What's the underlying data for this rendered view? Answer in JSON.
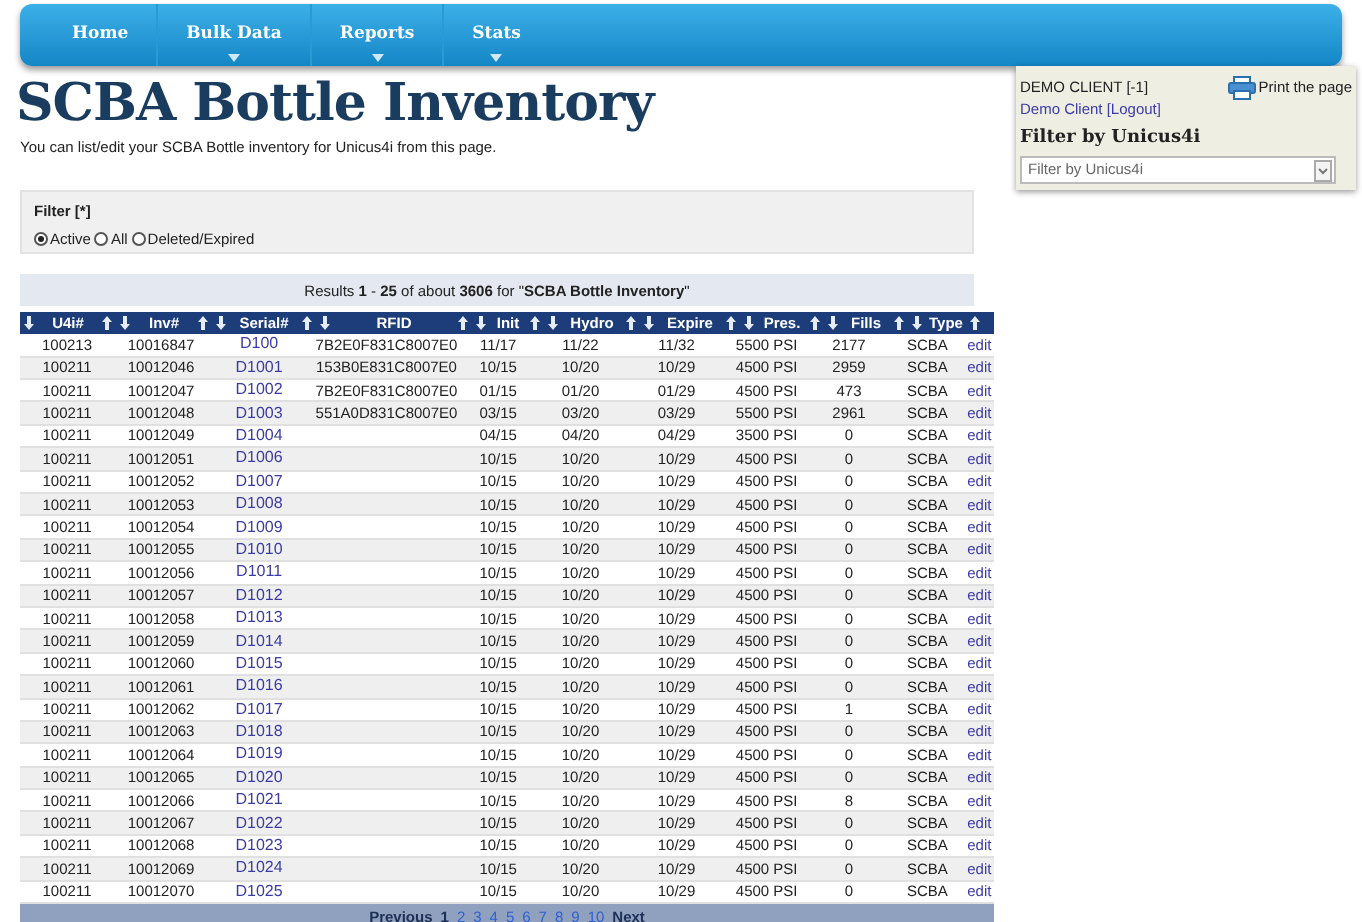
{
  "nav": [
    {
      "label": "Home",
      "has_menu": false
    },
    {
      "label": "Bulk Data",
      "has_menu": true
    },
    {
      "label": "Reports",
      "has_menu": true
    },
    {
      "label": "Stats",
      "has_menu": true
    }
  ],
  "title": "SCBA Bottle Inventory",
  "subtitle": "You can list/edit your SCBA Bottle inventory for Unicus4i from this page.",
  "filter": {
    "label": "Filter [*]",
    "options": [
      {
        "label": "Active",
        "selected": true
      },
      {
        "label": "All",
        "selected": false
      },
      {
        "label": "Deleted/Expired",
        "selected": false
      }
    ]
  },
  "results": "Results **1** - **25** of about **3606** for \"**SCBA Bottle Inventory**\"",
  "table": {
    "columns": [
      "U4i#",
      "Inv#",
      "Serial#",
      "RFID",
      "Init",
      "Hydro",
      "Expire",
      "Pres.",
      "Fills",
      "Type"
    ],
    "rows": [
      [
        "100213",
        "10016847",
        "D100",
        "7B2E0F831C8007E0",
        "11/17",
        "11/22",
        "11/32",
        "5500 PSI",
        "2177",
        "SCBA",
        "edit"
      ],
      [
        "100211",
        "10012046",
        "D1001",
        "153B0E831C8007E0",
        "10/15",
        "10/20",
        "10/29",
        "4500 PSI",
        "2959",
        "SCBA",
        "edit"
      ],
      [
        "100211",
        "10012047",
        "D1002",
        "7B2E0F831C8007E0",
        "01/15",
        "01/20",
        "01/29",
        "4500 PSI",
        "473",
        "SCBA",
        "edit"
      ],
      [
        "100211",
        "10012048",
        "D1003",
        "551A0D831C8007E0",
        "03/15",
        "03/20",
        "03/29",
        "5500 PSI",
        "2961",
        "SCBA",
        "edit"
      ],
      [
        "100211",
        "10012049",
        "D1004",
        "",
        "04/15",
        "04/20",
        "04/29",
        "3500 PSI",
        "0",
        "SCBA",
        "edit"
      ],
      [
        "100211",
        "10012051",
        "D1006",
        "",
        "10/15",
        "10/20",
        "10/29",
        "4500 PSI",
        "0",
        "SCBA",
        "edit"
      ],
      [
        "100211",
        "10012052",
        "D1007",
        "",
        "10/15",
        "10/20",
        "10/29",
        "4500 PSI",
        "0",
        "SCBA",
        "edit"
      ],
      [
        "100211",
        "10012053",
        "D1008",
        "",
        "10/15",
        "10/20",
        "10/29",
        "4500 PSI",
        "0",
        "SCBA",
        "edit"
      ],
      [
        "100211",
        "10012054",
        "D1009",
        "",
        "10/15",
        "10/20",
        "10/29",
        "4500 PSI",
        "0",
        "SCBA",
        "edit"
      ],
      [
        "100211",
        "10012055",
        "D1010",
        "",
        "10/15",
        "10/20",
        "10/29",
        "4500 PSI",
        "0",
        "SCBA",
        "edit"
      ],
      [
        "100211",
        "10012056",
        "D1011",
        "",
        "10/15",
        "10/20",
        "10/29",
        "4500 PSI",
        "0",
        "SCBA",
        "edit"
      ],
      [
        "100211",
        "10012057",
        "D1012",
        "",
        "10/15",
        "10/20",
        "10/29",
        "4500 PSI",
        "0",
        "SCBA",
        "edit"
      ],
      [
        "100211",
        "10012058",
        "D1013",
        "",
        "10/15",
        "10/20",
        "10/29",
        "4500 PSI",
        "0",
        "SCBA",
        "edit"
      ],
      [
        "100211",
        "10012059",
        "D1014",
        "",
        "10/15",
        "10/20",
        "10/29",
        "4500 PSI",
        "0",
        "SCBA",
        "edit"
      ],
      [
        "100211",
        "10012060",
        "D1015",
        "",
        "10/15",
        "10/20",
        "10/29",
        "4500 PSI",
        "0",
        "SCBA",
        "edit"
      ],
      [
        "100211",
        "10012061",
        "D1016",
        "",
        "10/15",
        "10/20",
        "10/29",
        "4500 PSI",
        "0",
        "SCBA",
        "edit"
      ],
      [
        "100211",
        "10012062",
        "D1017",
        "",
        "10/15",
        "10/20",
        "10/29",
        "4500 PSI",
        "1",
        "SCBA",
        "edit"
      ],
      [
        "100211",
        "10012063",
        "D1018",
        "",
        "10/15",
        "10/20",
        "10/29",
        "4500 PSI",
        "0",
        "SCBA",
        "edit"
      ],
      [
        "100211",
        "10012064",
        "D1019",
        "",
        "10/15",
        "10/20",
        "10/29",
        "4500 PSI",
        "0",
        "SCBA",
        "edit"
      ],
      [
        "100211",
        "10012065",
        "D1020",
        "",
        "10/15",
        "10/20",
        "10/29",
        "4500 PSI",
        "0",
        "SCBA",
        "edit"
      ],
      [
        "100211",
        "10012066",
        "D1021",
        "",
        "10/15",
        "10/20",
        "10/29",
        "4500 PSI",
        "8",
        "SCBA",
        "edit"
      ],
      [
        "100211",
        "10012067",
        "D1022",
        "",
        "10/15",
        "10/20",
        "10/29",
        "4500 PSI",
        "0",
        "SCBA",
        "edit"
      ],
      [
        "100211",
        "10012068",
        "D1023",
        "",
        "10/15",
        "10/20",
        "10/29",
        "4500 PSI",
        "0",
        "SCBA",
        "edit"
      ],
      [
        "100211",
        "10012069",
        "D1024",
        "",
        "10/15",
        "10/20",
        "10/29",
        "4500 PSI",
        "0",
        "SCBA",
        "edit"
      ],
      [
        "100211",
        "10012070",
        "D1025",
        "",
        "10/15",
        "10/20",
        "10/29",
        "4500 PSI",
        "0",
        "SCBA",
        "edit"
      ]
    ]
  },
  "pagination": {
    "previous": "Previous",
    "pages": [
      {
        "label": "1",
        "selected": true
      },
      {
        "label": "2",
        "selected": false
      },
      {
        "label": "3",
        "selected": false
      },
      {
        "label": "4",
        "selected": false
      },
      {
        "label": "5",
        "selected": false
      },
      {
        "label": "6",
        "selected": false
      },
      {
        "label": "7",
        "selected": false
      },
      {
        "label": "8",
        "selected": false
      },
      {
        "label": "9",
        "selected": false
      },
      {
        "label": "10",
        "selected": false
      }
    ],
    "next": "Next"
  },
  "account": {
    "client": "DEMO CLIENT [-1]",
    "user_link": "Demo Client [Logout]",
    "print": "Print the page",
    "filter_title": "Filter by Unicus4i",
    "filter_select": "Filter by Unicus4i"
  }
}
